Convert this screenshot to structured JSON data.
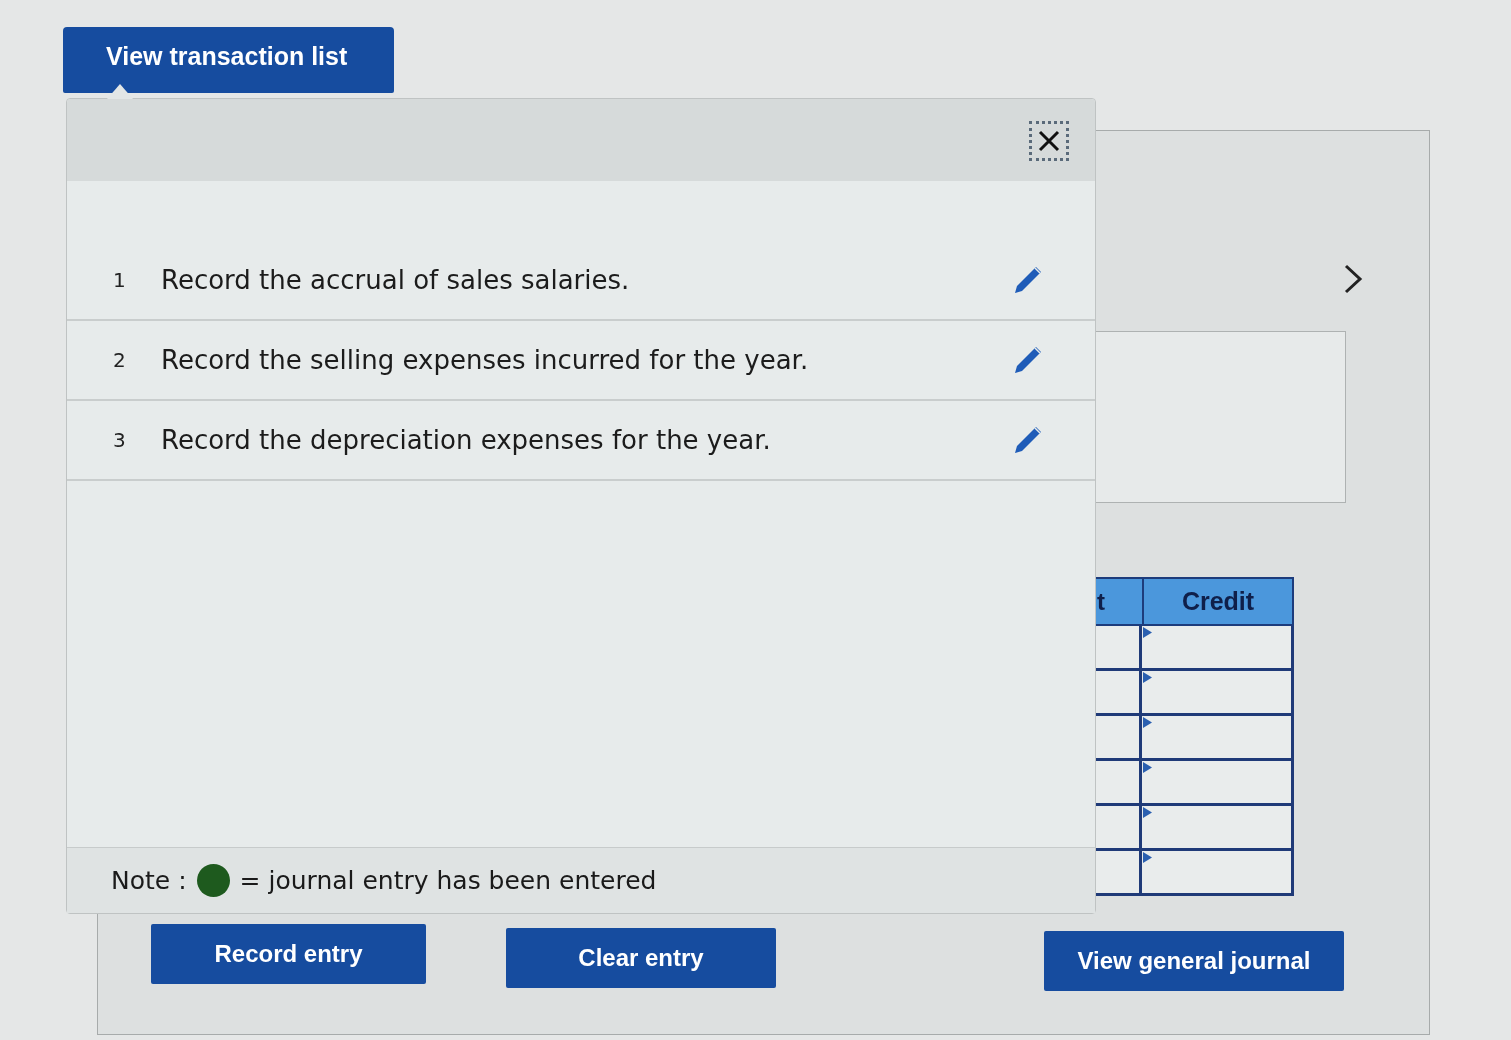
{
  "view_transaction_list_button": {
    "label": "View transaction list"
  },
  "transaction_list": {
    "transactions": [
      {
        "number": "1",
        "text": "Record the accrual of sales salaries."
      },
      {
        "number": "2",
        "text": "Record the selling expenses incurred for the year."
      },
      {
        "number": "3",
        "text": "Record the depreciation expenses for the year."
      }
    ],
    "note": {
      "label": "Note :",
      "legend_text": "= journal entry has been entered"
    }
  },
  "journal_table": {
    "columns": [
      "t",
      "Credit"
    ],
    "rows": [
      {
        "kind": "entry"
      },
      {
        "kind": "entry"
      },
      {
        "kind": "entry"
      },
      {
        "kind": "entry"
      },
      {
        "kind": "entry"
      },
      {
        "kind": "entry"
      }
    ]
  },
  "actions": {
    "record_entry": "Record entry",
    "clear_entry": "Clear entry",
    "view_general_journal": "View general journal"
  }
}
